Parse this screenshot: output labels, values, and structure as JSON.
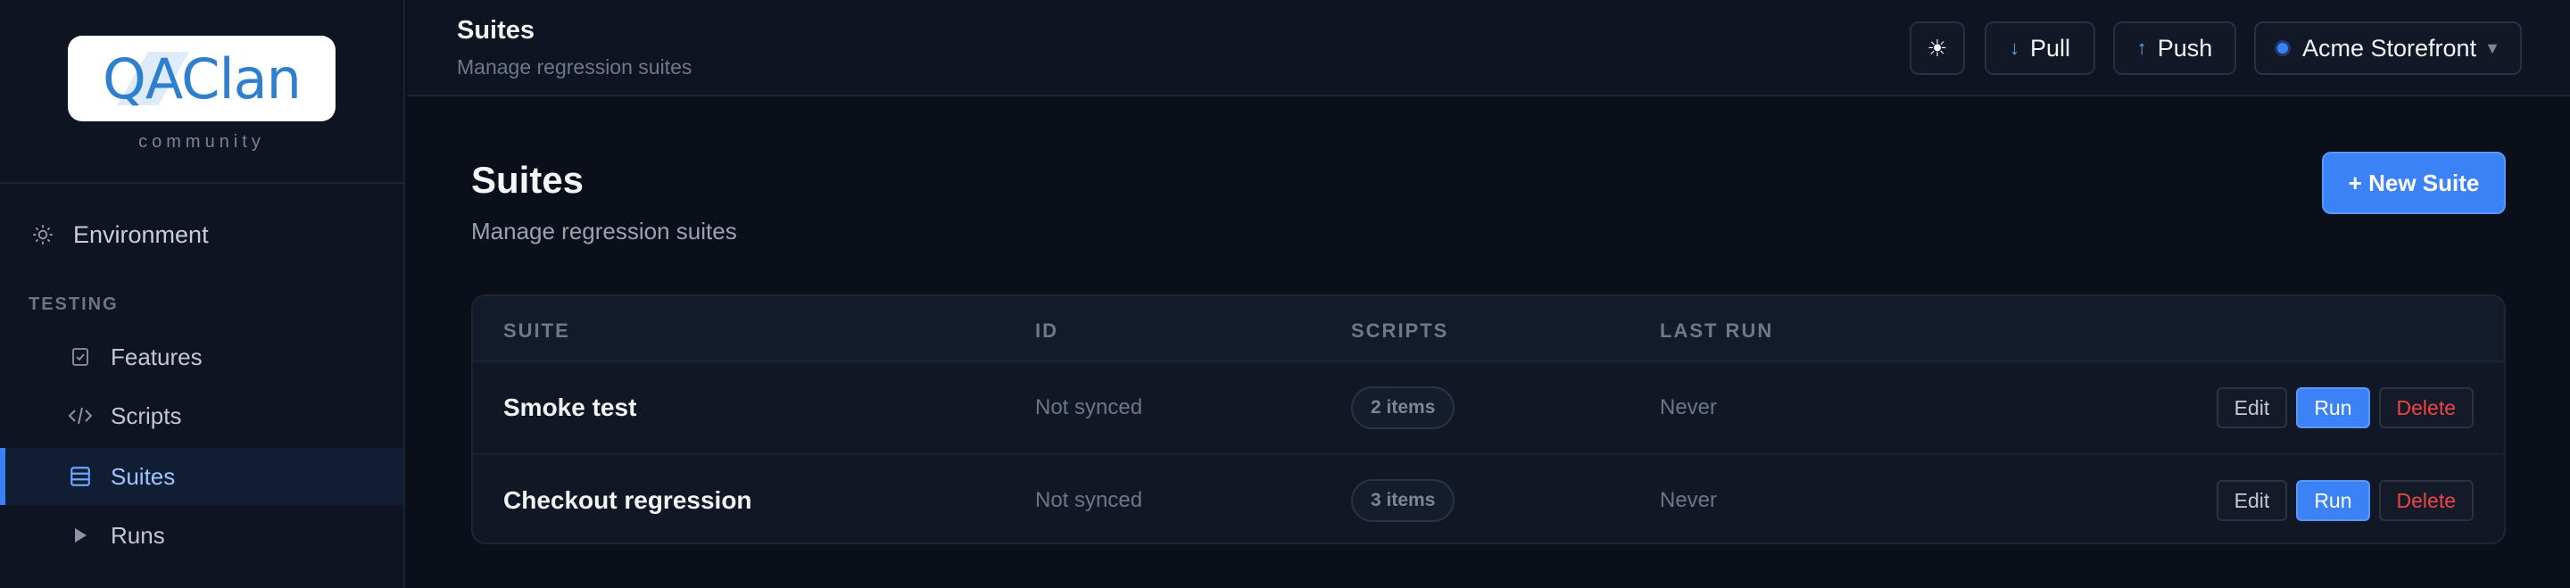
{
  "brand": {
    "logo_text": "QAClan",
    "tagline": "community"
  },
  "sidebar": {
    "environment_label": "Environment",
    "section_label": "TESTING",
    "items": [
      {
        "label": "Features",
        "icon": "checklist-icon"
      },
      {
        "label": "Scripts",
        "icon": "code-icon"
      },
      {
        "label": "Suites",
        "icon": "stack-icon",
        "active": true
      },
      {
        "label": "Runs",
        "icon": "play-icon"
      }
    ]
  },
  "topbar": {
    "title": "Suites",
    "subtitle": "Manage regression suites",
    "theme_icon": "☀",
    "pull_label": "Pull",
    "push_label": "Push",
    "project_label": "Acme Storefront"
  },
  "main": {
    "title": "Suites",
    "subtitle": "Manage regression suites",
    "new_suite_label": "+ New Suite"
  },
  "table": {
    "headers": [
      "SUITE",
      "ID",
      "SCRIPTS",
      "LAST RUN"
    ],
    "rows": [
      {
        "name": "Smoke test",
        "id": "Not synced",
        "scripts": "2 items",
        "last_run": "Never"
      },
      {
        "name": "Checkout regression",
        "id": "Not synced",
        "scripts": "3 items",
        "last_run": "Never"
      }
    ],
    "actions": {
      "edit": "Edit",
      "run": "Run",
      "delete": "Delete"
    }
  },
  "colors": {
    "accent": "#3b82f6",
    "danger": "#ef4444",
    "background": "#0b0f1a",
    "panel": "#0f1422"
  }
}
